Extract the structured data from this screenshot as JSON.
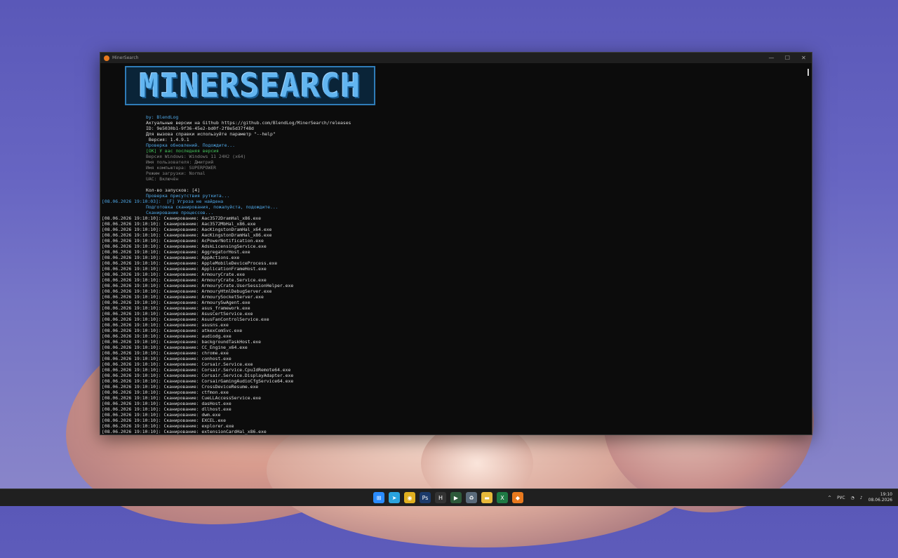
{
  "window": {
    "title": "MinerSearch",
    "controls": [
      "—",
      "☐",
      "✕"
    ]
  },
  "logo": "MINERSEARCH",
  "header_lines": [
    {
      "text": "by: BlendLog",
      "cls": "c-blue"
    },
    {
      "text": "Актуальные версии на Github https://github.com/BlendLog/MinerSearch/releases",
      "cls": "c-white"
    },
    {
      "text": "ID: 9e5030b1-9f36-45e2-bd0f-2f8e5d37f48d",
      "cls": "c-white"
    },
    {
      "text": "Для вызова справки используйте параметр \"--help\"",
      "cls": "c-white"
    },
    {
      "text": " Версия: 1.4.9.1",
      "cls": "c-white"
    },
    {
      "text": "Проверка обновлений. Подождите...",
      "cls": "c-blue"
    },
    {
      "text": "[OK] У вас последняя версия",
      "cls": "c-green"
    },
    {
      "text": "Версия Windows: Windows 11 24H2 (x64)",
      "cls": "c-gray"
    },
    {
      "text": "Имя пользователя: Дмитрий",
      "cls": "c-gray"
    },
    {
      "text": "Имя компьютера: SUPERPOWER",
      "cls": "c-gray"
    },
    {
      "text": "Режим загрузки: Normal",
      "cls": "c-gray"
    },
    {
      "text": "UAC: Включён",
      "cls": "c-gray"
    },
    {
      "text": "",
      "cls": "c-gray"
    },
    {
      "text": "Кол-во запусков: [4]",
      "cls": "c-white"
    },
    {
      "text": "Проверка присутствия руткита...",
      "cls": "c-blue"
    }
  ],
  "rootkit_line": "[08.06.2026 19:10:03]:  [F] Угроза не найдена",
  "prep_lines": [
    {
      "text": "Подготовка сканирования, пожалуйста, подождите...",
      "cls": "c-blue"
    },
    {
      "text": "Сканирование процессов...",
      "cls": "c-blue"
    }
  ],
  "scan_prefix": "[08.06.2026 19:10:10]: Сканирование: ",
  "scan_items": [
    "Aac3572DramHal_x86.exe",
    "Aac3572MbHal_x86.exe",
    "AacKingstonDramHal_x64.exe",
    "AacKingstonDramHal_x86.exe",
    "AcPowerNotification.exe",
    "AdskLicensingService.exe",
    "AggregatorHost.exe",
    "AppActions.exe",
    "AppleMobileDeviceProcess.exe",
    "ApplicationFrameHost.exe",
    "ArmouryCrate.exe",
    "ArmouryCrate.Service.exe",
    "ArmouryCrate.UserSessionHelper.exe",
    "ArmouryHtmlDebugServer.exe",
    "ArmourySocketServer.exe",
    "ArmourySwAgent.exe",
    "asus_framework.exe",
    "AsusCertService.exe",
    "AsusFanControlService.exe",
    "asusns.exe",
    "atkexComSvc.exe",
    "audiodg.exe",
    "backgroundTaskHost.exe",
    "CC_Engine_x64.exe",
    "chrome.exe",
    "conhost.exe",
    "Corsair.Service.exe",
    "Corsair.Service.CpuIdRemote64.exe",
    "Corsair.Service.DisplayAdapter.exe",
    "CorsairGamingAudioCfgService64.exe",
    "CrossDeviceResume.exe",
    "ctfmon.exe",
    "CueLLAccessService.exe",
    "dasHost.exe",
    "dllhost.exe",
    "dwm.exe",
    "EXCEL.exe",
    "explorer.exe",
    "extensionCardHal_x86.exe"
  ],
  "taskbar": {
    "apps": [
      {
        "name": "windows-start-icon",
        "glyph": "⊞",
        "color": "#2a8cff"
      },
      {
        "name": "telegram-icon",
        "glyph": "➤",
        "color": "#2aa3de"
      },
      {
        "name": "chrome-icon",
        "glyph": "◉",
        "color": "#e0b020"
      },
      {
        "name": "photoshop-icon",
        "glyph": "Ps",
        "color": "#1b3a6a"
      },
      {
        "name": "hwinfo-icon",
        "glyph": "H",
        "color": "#333333"
      },
      {
        "name": "terminal-icon",
        "glyph": "▶",
        "color": "#2d5a3a"
      },
      {
        "name": "recycle-bin-icon",
        "glyph": "♻",
        "color": "#5a6a7a"
      },
      {
        "name": "folder-icon",
        "glyph": "▬",
        "color": "#e8b93a"
      },
      {
        "name": "excel-icon",
        "glyph": "X",
        "color": "#1e7a44"
      },
      {
        "name": "minersearch-icon",
        "glyph": "◆",
        "color": "#e8791e"
      }
    ],
    "tray_chevron": "^",
    "language": "РУС",
    "time": "19:10",
    "date": "08.06.2026"
  }
}
